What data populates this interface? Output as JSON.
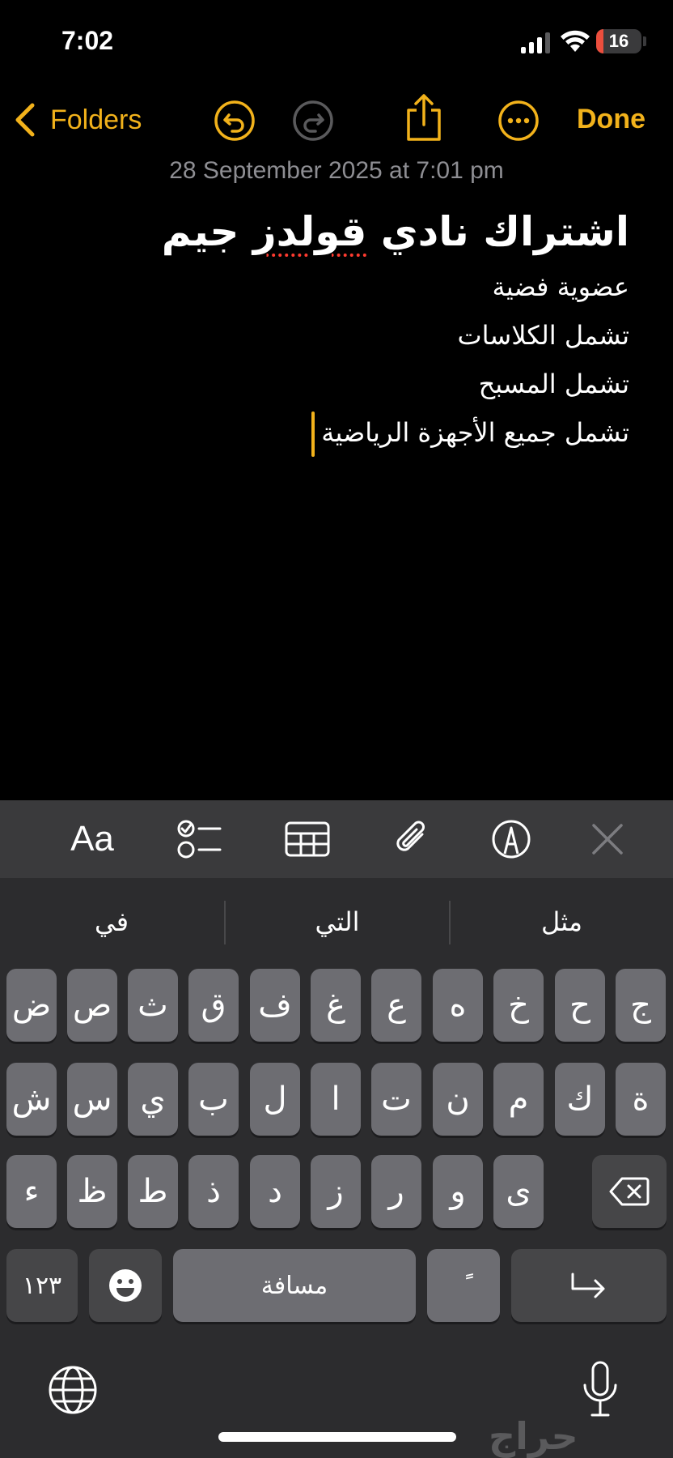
{
  "status": {
    "time": "7:02",
    "battery": "16",
    "battery_level": 0.16,
    "battery_color": "#eb4e3d"
  },
  "nav": {
    "back_label": "Folders",
    "done_label": "Done",
    "accent": "#f2b21b",
    "icons": [
      "chevron-left-icon",
      "undo-icon",
      "redo-icon",
      "share-icon",
      "more-icon"
    ]
  },
  "note": {
    "date": "28 September 2025 at 7:01 pm",
    "title_part1": "اشتراك نادي ",
    "title_misspelled": "قولدز",
    "title_part2": " جيم",
    "lines": [
      "عضوية فضية",
      "تشمل الكلاسات",
      "تشمل المسبح",
      "تشمل جميع الأجهزة الرياضية"
    ]
  },
  "toolbar": {
    "format_label": "Aa",
    "icons": [
      "checklist-icon",
      "table-icon",
      "attachment-icon",
      "markup-icon",
      "close-icon"
    ]
  },
  "suggestions": [
    "في",
    "التي",
    "مثل"
  ],
  "keys": {
    "row1": [
      "ض",
      "ص",
      "ث",
      "ق",
      "ف",
      "غ",
      "ع",
      "ه",
      "خ",
      "ح",
      "ج"
    ],
    "row2": [
      "ش",
      "س",
      "ي",
      "ب",
      "ل",
      "ا",
      "ت",
      "ن",
      "م",
      "ك",
      "ة"
    ],
    "row3": [
      "ء",
      "ظ",
      "ط",
      "ذ",
      "د",
      "ز",
      "ر",
      "و",
      "ى"
    ],
    "numbers": "١٢٣",
    "space": "مسافة",
    "tanween": "ًً"
  },
  "watermark": "حراج"
}
